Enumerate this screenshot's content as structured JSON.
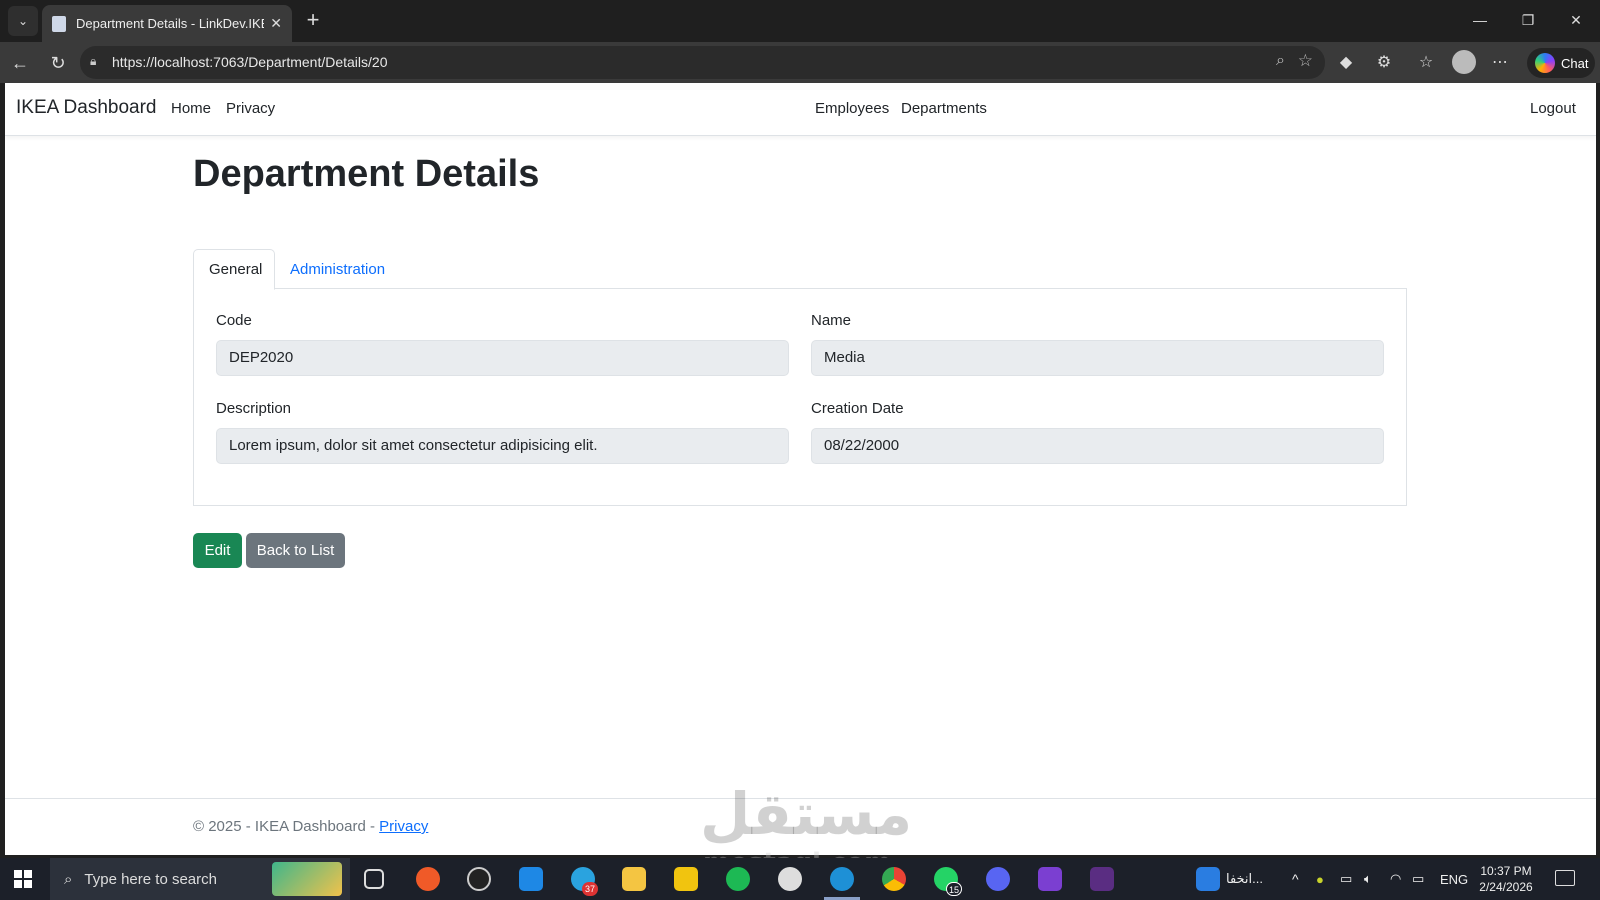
{
  "browser": {
    "tab_title": "Department Details - LinkDev.IKEA",
    "tab_close": "✕",
    "new_tab": "+",
    "url": "https://localhost:7063/Department/Details/20",
    "chat_label": "Chat",
    "window_controls": [
      "—",
      "❐",
      "✕"
    ]
  },
  "navbar": {
    "brand": "IKEA Dashboard",
    "links": [
      "Home",
      "Privacy",
      "Employees",
      "Departments",
      "Logout"
    ]
  },
  "page": {
    "title": "Department Details",
    "tabs": [
      "General",
      "Administration"
    ],
    "fields": {
      "code": {
        "label": "Code",
        "value": "DEP2020"
      },
      "name": {
        "label": "Name",
        "value": "Media"
      },
      "description": {
        "label": "Description",
        "value": "Lorem ipsum, dolor sit amet consectetur adipisicing elit."
      },
      "creation_date": {
        "label": "Creation Date",
        "value": "08/22/2000"
      }
    },
    "buttons": {
      "edit": "Edit",
      "back": "Back to List"
    }
  },
  "footer": {
    "text": "© 2025 - IKEA Dashboard - ",
    "link": "Privacy"
  },
  "watermark": {
    "main": "مستقل",
    "sub": "mostaql.com"
  },
  "taskbar": {
    "search_placeholder": "Type here to search",
    "badges": {
      "telegram": "37",
      "whatsapp": "15"
    },
    "news": "انخفا...",
    "language": "ENG",
    "time": "10:37 PM",
    "date": "2/24/2026"
  }
}
